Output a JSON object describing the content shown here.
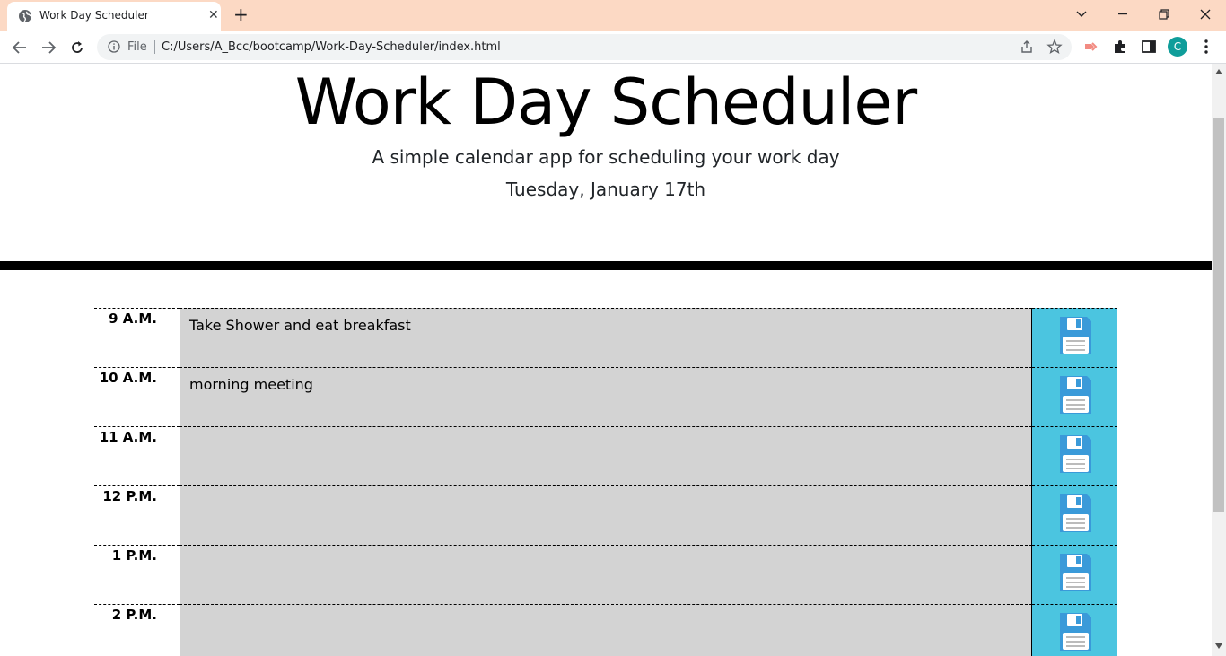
{
  "browser": {
    "tab_title": "Work Day Scheduler",
    "new_tab_symbol": "+",
    "close_symbol": "✕",
    "file_label": "File",
    "url": "C:/Users/A_Bcc/bootcamp/Work-Day-Scheduler/index.html",
    "avatar_letter": "C",
    "colors": {
      "tabbar": "#fcd9c4",
      "avatar": "#0f9d9a"
    }
  },
  "header": {
    "title": "Work Day Scheduler",
    "lead": "A simple calendar app for scheduling your work day",
    "current_day": "Tuesday, January 17th"
  },
  "schedule": {
    "rows": [
      {
        "hour": "9 A.M.",
        "entry": "Take Shower and eat breakfast"
      },
      {
        "hour": "10 A.M.",
        "entry": "morning meeting"
      },
      {
        "hour": "11 A.M.",
        "entry": ""
      },
      {
        "hour": "12 P.M.",
        "entry": ""
      },
      {
        "hour": "1 P.M.",
        "entry": ""
      },
      {
        "hour": "2 P.M.",
        "entry": ""
      }
    ],
    "colors": {
      "past_row": "#d3d3d3",
      "save_button": "#4bc5e0",
      "save_icon": "#3a9ad9"
    }
  }
}
